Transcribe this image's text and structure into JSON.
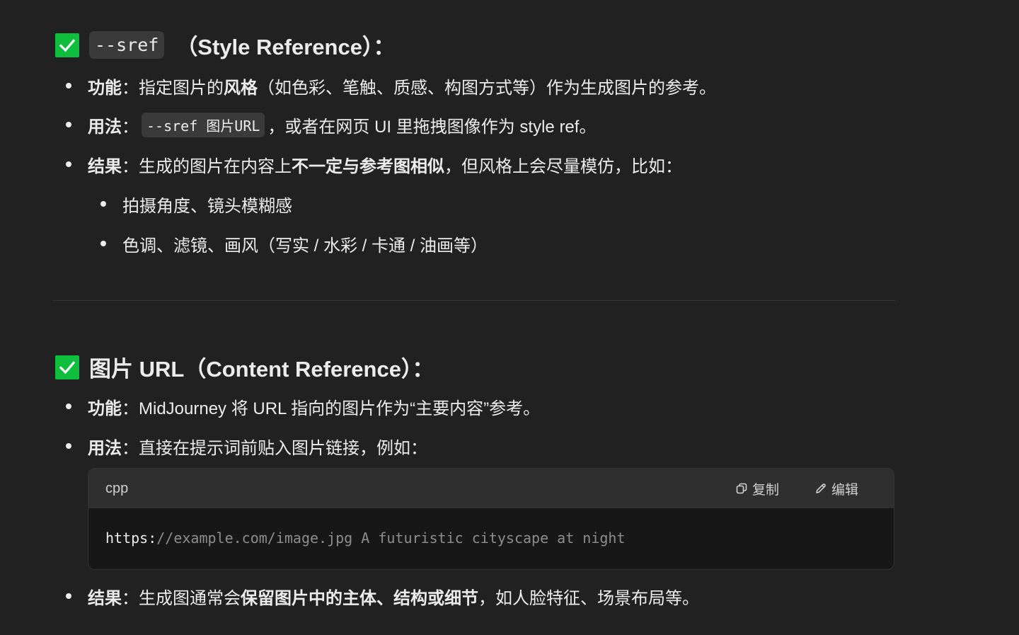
{
  "section1": {
    "heading_code": "--sref",
    "heading_text": "（Style Reference）：",
    "bullets": [
      {
        "label": "功能",
        "sep": "：",
        "text_before": "指定图片的",
        "bold_mid": "风格",
        "text_after": "（如色彩、笔触、质感、构图方式等）作为生成图片的参考。"
      },
      {
        "label": "用法",
        "sep": "：",
        "code": "--sref 图片URL",
        "text_after": "，或者在网页 UI 里拖拽图像作为 style ref。"
      },
      {
        "label": "结果",
        "sep": "：",
        "text_before": "生成的图片在内容上",
        "bold_mid": "不一定与参考图相似",
        "text_after": "，但风格上会尽量模仿，比如："
      }
    ],
    "sub_bullets": [
      "拍摄角度、镜头模糊感",
      "色调、滤镜、画风（写实 / 水彩 / 卡通 / 油画等）"
    ]
  },
  "section2": {
    "heading_text": "图片 URL（Content Reference）：",
    "bullets": [
      {
        "label": "功能",
        "sep": "：",
        "text": "MidJourney 将 URL 指向的图片作为“主要内容”参考。"
      },
      {
        "label": "用法",
        "sep": "：",
        "text": "直接在提示词前贴入图片链接，例如："
      },
      {
        "label": "结果",
        "sep": "：",
        "text_before": "生成图通常会",
        "bold_mid": "保留图片中的主体、结构或细节",
        "text_after": "，如人脸特征、场景布局等。"
      }
    ],
    "code_block": {
      "language": "cpp",
      "copy_label": "复制",
      "edit_label": "编辑",
      "code_keyword": "https:",
      "code_rest": "//example.com/image.jpg A futuristic cityscape at night"
    }
  },
  "colors": {
    "background": "#212121",
    "check_green": "#0fbe3c",
    "text": "#ececec",
    "code_bg": "#171717",
    "code_header_bg": "#2f2f2f"
  },
  "icons": {
    "check": "check-mark-icon",
    "copy": "copy-icon",
    "edit": "pencil-icon",
    "bullet": "bullet-dot-icon"
  }
}
